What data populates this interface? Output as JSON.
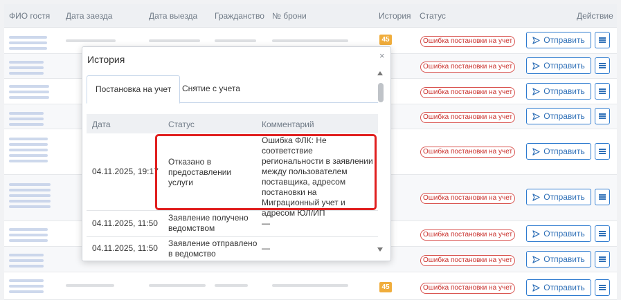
{
  "table": {
    "headers": {
      "guest": "ФИО гостя",
      "arrival": "Дата заезда",
      "departure": "Дата выезда",
      "citizenship": "Гражданство",
      "booking": "№ брони",
      "history": "История",
      "status": "Статус",
      "action": "Действие"
    },
    "rows": [
      {
        "history": "45",
        "status": "Ошибка постановки на учет",
        "action": "Отправить"
      },
      {
        "status": "Ошибка постановки на учет",
        "action": "Отправить"
      },
      {
        "status": "Ошибка постановки на учет",
        "action": "Отправить"
      },
      {
        "status": "Ошибка постановки на учет",
        "action": "Отправить"
      },
      {
        "status": "Ошибка постановки на учет",
        "action": "Отправить"
      },
      {
        "status": "Ошибка постановки на учет",
        "action": "Отправить"
      },
      {
        "status": "Ошибка постановки на учет",
        "action": "Отправить"
      },
      {
        "status": "Ошибка постановки на учет",
        "action": "Отправить"
      },
      {
        "history": "45",
        "status": "Ошибка постановки на учет",
        "action": "Отправить"
      }
    ]
  },
  "modal": {
    "title": "История",
    "close": "×",
    "tabs": [
      "Постановка на учет",
      "Снятие с учета"
    ],
    "headers": {
      "date": "Дата",
      "status": "Статус",
      "comment": "Комментарий"
    },
    "entries": [
      {
        "date": "04.11.2025, 19:17",
        "status_lines": [
          "Отказано в",
          "предоставлении",
          "услуги"
        ],
        "comment_lines": [
          "Ошибка ФЛК: Не соответствие",
          "региональности в заявлении",
          "между пользователем",
          "поставщика, адресом",
          "постановки на",
          "Миграционный учет и",
          "адресом ЮЛ/ИП"
        ]
      },
      {
        "date": "04.11.2025, 11:50",
        "status_lines": [
          "Заявление получено",
          "ведомством"
        ],
        "comment_lines": [
          "—"
        ]
      },
      {
        "date": "04.11.2025, 11:50",
        "status_lines": [
          "Заявление отправлено",
          "в ведомство"
        ],
        "comment_lines": [
          "—"
        ]
      }
    ]
  },
  "colors": {
    "accent": "#2e6fb7",
    "error": "#d9534f",
    "badge": "#f0ad3c",
    "highlight": "#e01f1f"
  },
  "icons": {
    "send": "paper-plane-icon",
    "menu": "hamburger-icon",
    "close": "close-icon"
  }
}
